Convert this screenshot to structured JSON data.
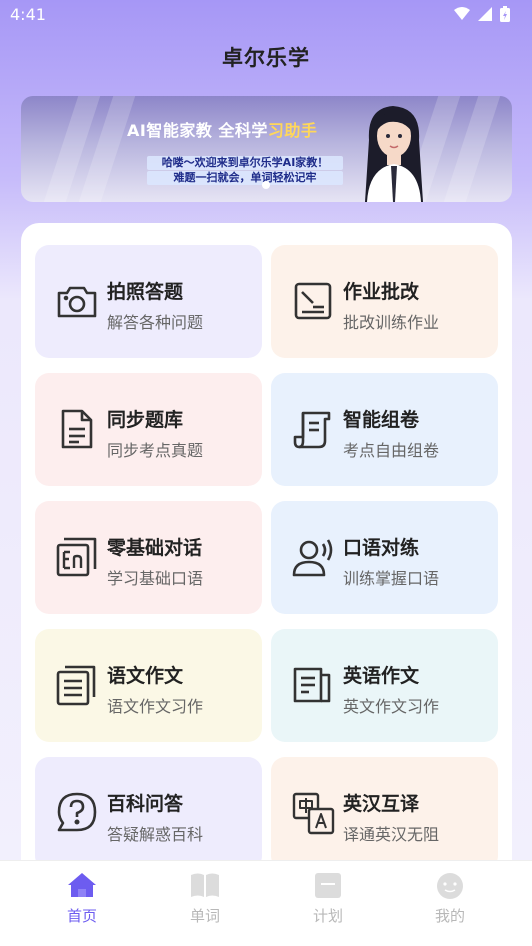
{
  "status": {
    "time": "4:41"
  },
  "app": {
    "title": "卓尔乐学"
  },
  "banner": {
    "headline_part1": "AI智能家教 全科学",
    "headline_part2": "习助手",
    "line1": "哈喽～欢迎来到卓尔乐学AI家教！",
    "line2": "难题一扫就会，单词轻松记牢"
  },
  "features": [
    {
      "title": "拍照答题",
      "subtitle": "解答各种问题",
      "icon": "camera-icon",
      "bg": "#eeecfd"
    },
    {
      "title": "作业批改",
      "subtitle": "批改训练作业",
      "icon": "grading-icon",
      "bg": "#fdf2ea"
    },
    {
      "title": "同步题库",
      "subtitle": "同步考点真题",
      "icon": "document-icon",
      "bg": "#fdeeee"
    },
    {
      "title": "智能组卷",
      "subtitle": "考点自由组卷",
      "icon": "scroll-icon",
      "bg": "#e8f1fd"
    },
    {
      "title": "零基础对话",
      "subtitle": "学习基础口语",
      "icon": "english-icon",
      "bg": "#fdeeee"
    },
    {
      "title": "口语对练",
      "subtitle": "训练掌握口语",
      "icon": "speaking-icon",
      "bg": "#e8f1fd"
    },
    {
      "title": "语文作文",
      "subtitle": "语文作文习作",
      "icon": "notes-icon",
      "bg": "#fbf8e6"
    },
    {
      "title": "英语作文",
      "subtitle": "英文作文习作",
      "icon": "essay-icon",
      "bg": "#eaf6f8"
    },
    {
      "title": "百科问答",
      "subtitle": "答疑解惑百科",
      "icon": "question-icon",
      "bg": "#eeecfd"
    },
    {
      "title": "英汉互译",
      "subtitle": "译通英汉无阻",
      "icon": "translate-icon",
      "bg": "#fdf2ea"
    }
  ],
  "nav": {
    "home": "首页",
    "words": "单词",
    "plan": "计划",
    "mine": "我的",
    "active_color": "#6d5cf0",
    "inactive_color": "#b8b8b8"
  }
}
